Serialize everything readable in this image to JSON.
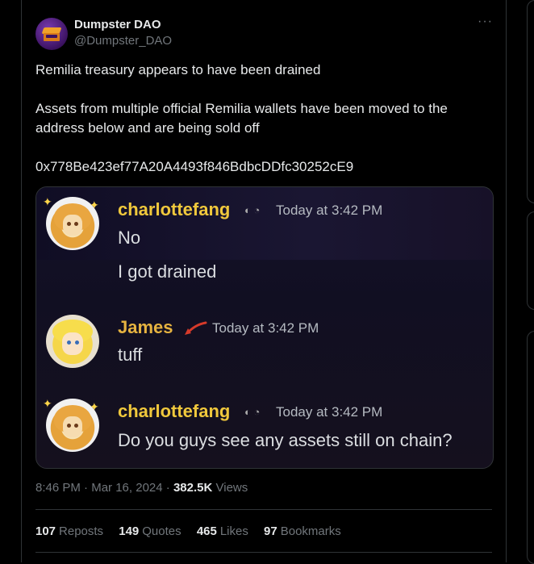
{
  "author": {
    "name": "Dumpster DAO",
    "handle": "@Dumpster_DAO"
  },
  "tweet": {
    "line1": "Remilia treasury appears to have been drained",
    "line2": "Assets from multiple official Remilia wallets have been moved to the",
    "line3": "address below and are being sold off",
    "address": "0x778Be423ef77A20A4493f846BdbcDDfc30252cE9"
  },
  "screenshot": {
    "messages": [
      {
        "user": "charlottefang",
        "time": "Today at 3:42 PM",
        "lines": [
          "No",
          "I got drained"
        ]
      },
      {
        "user": "James",
        "time": "Today at 3:42 PM",
        "lines": [
          "tuff"
        ]
      },
      {
        "user": "charlottefang",
        "time": "Today at 3:42 PM",
        "lines": [
          "Do you guys see any assets still on chain?"
        ]
      }
    ]
  },
  "meta": {
    "time": "8:46 PM",
    "sep1": "·",
    "date": "Mar 16, 2024",
    "sep2": "·",
    "views_count": "382.5K",
    "views_label": "Views"
  },
  "stats": {
    "reposts_count": "107",
    "reposts_label": "Reposts",
    "quotes_count": "149",
    "quotes_label": "Quotes",
    "likes_count": "465",
    "likes_label": "Likes",
    "bookmarks_count": "97",
    "bookmarks_label": "Bookmarks"
  },
  "icons": {
    "more": "more-icon"
  },
  "colors": {
    "background": "#000000",
    "text": "#e7e9ea",
    "muted": "#71767b",
    "border": "#2f3336",
    "discord_name_yellow": "#f0c83c"
  }
}
